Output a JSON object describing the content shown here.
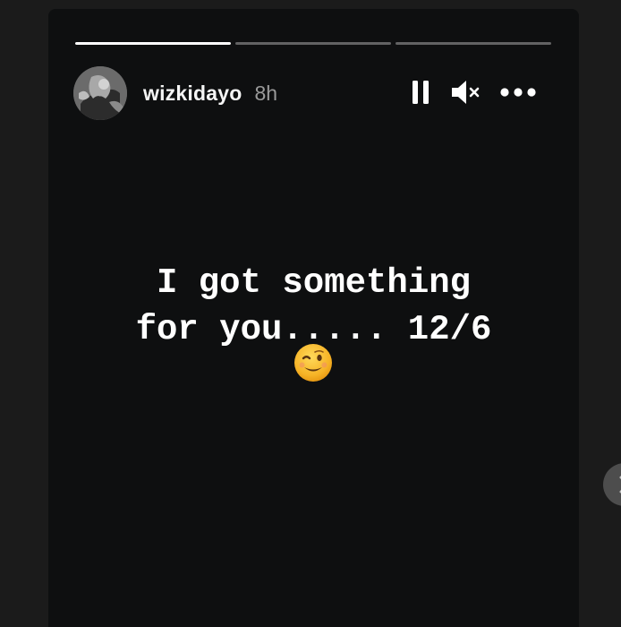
{
  "story": {
    "username": "wizkidayo",
    "time_ago": "8h",
    "progress_segments": [
      {
        "fill": 1.0
      },
      {
        "fill": 0.0
      },
      {
        "fill": 0.0
      }
    ],
    "text_lines": [
      "I got something",
      "for you..... 12/6"
    ],
    "emoji": "winking-face"
  },
  "controls": {
    "pause_icon": "pause-icon",
    "mute_icon": "speaker-muted-icon",
    "more_icon": "more-options-icon"
  },
  "colors": {
    "background": "#1b1b1b",
    "card": "#0e0f10",
    "text": "#ffffff",
    "muted_text": "#9a9a9a",
    "progress_track": "rgba(255,255,255,0.35)",
    "progress_fill": "#ffffff"
  }
}
